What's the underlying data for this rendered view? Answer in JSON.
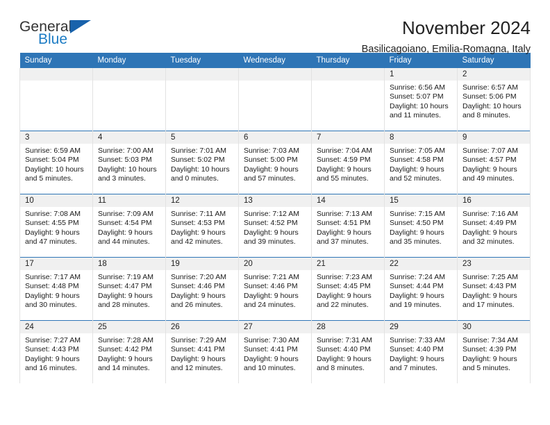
{
  "brand": {
    "name_top": "General",
    "name_bottom": "Blue",
    "accent_color": "#1862ab",
    "blue_text_color": "#1d7cc4"
  },
  "header": {
    "title": "November 2024",
    "subtitle": "Basilicagoiano, Emilia-Romagna, Italy"
  },
  "calendar": {
    "header_bg": "#2e75b6",
    "daynum_bg": "#f0f0f0",
    "weekdays": [
      "Sunday",
      "Monday",
      "Tuesday",
      "Wednesday",
      "Thursday",
      "Friday",
      "Saturday"
    ],
    "weeks": [
      [
        {
          "day": "",
          "empty": true,
          "sunrise": "",
          "sunset": "",
          "daylight_1": "",
          "daylight_2": ""
        },
        {
          "day": "",
          "empty": true,
          "sunrise": "",
          "sunset": "",
          "daylight_1": "",
          "daylight_2": ""
        },
        {
          "day": "",
          "empty": true,
          "sunrise": "",
          "sunset": "",
          "daylight_1": "",
          "daylight_2": ""
        },
        {
          "day": "",
          "empty": true,
          "sunrise": "",
          "sunset": "",
          "daylight_1": "",
          "daylight_2": ""
        },
        {
          "day": "",
          "empty": true,
          "sunrise": "",
          "sunset": "",
          "daylight_1": "",
          "daylight_2": ""
        },
        {
          "day": "1",
          "sunrise": "Sunrise: 6:56 AM",
          "sunset": "Sunset: 5:07 PM",
          "daylight_1": "Daylight: 10 hours",
          "daylight_2": "and 11 minutes."
        },
        {
          "day": "2",
          "sunrise": "Sunrise: 6:57 AM",
          "sunset": "Sunset: 5:06 PM",
          "daylight_1": "Daylight: 10 hours",
          "daylight_2": "and 8 minutes."
        }
      ],
      [
        {
          "day": "3",
          "sunrise": "Sunrise: 6:59 AM",
          "sunset": "Sunset: 5:04 PM",
          "daylight_1": "Daylight: 10 hours",
          "daylight_2": "and 5 minutes."
        },
        {
          "day": "4",
          "sunrise": "Sunrise: 7:00 AM",
          "sunset": "Sunset: 5:03 PM",
          "daylight_1": "Daylight: 10 hours",
          "daylight_2": "and 3 minutes."
        },
        {
          "day": "5",
          "sunrise": "Sunrise: 7:01 AM",
          "sunset": "Sunset: 5:02 PM",
          "daylight_1": "Daylight: 10 hours",
          "daylight_2": "and 0 minutes."
        },
        {
          "day": "6",
          "sunrise": "Sunrise: 7:03 AM",
          "sunset": "Sunset: 5:00 PM",
          "daylight_1": "Daylight: 9 hours",
          "daylight_2": "and 57 minutes."
        },
        {
          "day": "7",
          "sunrise": "Sunrise: 7:04 AM",
          "sunset": "Sunset: 4:59 PM",
          "daylight_1": "Daylight: 9 hours",
          "daylight_2": "and 55 minutes."
        },
        {
          "day": "8",
          "sunrise": "Sunrise: 7:05 AM",
          "sunset": "Sunset: 4:58 PM",
          "daylight_1": "Daylight: 9 hours",
          "daylight_2": "and 52 minutes."
        },
        {
          "day": "9",
          "sunrise": "Sunrise: 7:07 AM",
          "sunset": "Sunset: 4:57 PM",
          "daylight_1": "Daylight: 9 hours",
          "daylight_2": "and 49 minutes."
        }
      ],
      [
        {
          "day": "10",
          "sunrise": "Sunrise: 7:08 AM",
          "sunset": "Sunset: 4:55 PM",
          "daylight_1": "Daylight: 9 hours",
          "daylight_2": "and 47 minutes."
        },
        {
          "day": "11",
          "sunrise": "Sunrise: 7:09 AM",
          "sunset": "Sunset: 4:54 PM",
          "daylight_1": "Daylight: 9 hours",
          "daylight_2": "and 44 minutes."
        },
        {
          "day": "12",
          "sunrise": "Sunrise: 7:11 AM",
          "sunset": "Sunset: 4:53 PM",
          "daylight_1": "Daylight: 9 hours",
          "daylight_2": "and 42 minutes."
        },
        {
          "day": "13",
          "sunrise": "Sunrise: 7:12 AM",
          "sunset": "Sunset: 4:52 PM",
          "daylight_1": "Daylight: 9 hours",
          "daylight_2": "and 39 minutes."
        },
        {
          "day": "14",
          "sunrise": "Sunrise: 7:13 AM",
          "sunset": "Sunset: 4:51 PM",
          "daylight_1": "Daylight: 9 hours",
          "daylight_2": "and 37 minutes."
        },
        {
          "day": "15",
          "sunrise": "Sunrise: 7:15 AM",
          "sunset": "Sunset: 4:50 PM",
          "daylight_1": "Daylight: 9 hours",
          "daylight_2": "and 35 minutes."
        },
        {
          "day": "16",
          "sunrise": "Sunrise: 7:16 AM",
          "sunset": "Sunset: 4:49 PM",
          "daylight_1": "Daylight: 9 hours",
          "daylight_2": "and 32 minutes."
        }
      ],
      [
        {
          "day": "17",
          "sunrise": "Sunrise: 7:17 AM",
          "sunset": "Sunset: 4:48 PM",
          "daylight_1": "Daylight: 9 hours",
          "daylight_2": "and 30 minutes."
        },
        {
          "day": "18",
          "sunrise": "Sunrise: 7:19 AM",
          "sunset": "Sunset: 4:47 PM",
          "daylight_1": "Daylight: 9 hours",
          "daylight_2": "and 28 minutes."
        },
        {
          "day": "19",
          "sunrise": "Sunrise: 7:20 AM",
          "sunset": "Sunset: 4:46 PM",
          "daylight_1": "Daylight: 9 hours",
          "daylight_2": "and 26 minutes."
        },
        {
          "day": "20",
          "sunrise": "Sunrise: 7:21 AM",
          "sunset": "Sunset: 4:46 PM",
          "daylight_1": "Daylight: 9 hours",
          "daylight_2": "and 24 minutes."
        },
        {
          "day": "21",
          "sunrise": "Sunrise: 7:23 AM",
          "sunset": "Sunset: 4:45 PM",
          "daylight_1": "Daylight: 9 hours",
          "daylight_2": "and 22 minutes."
        },
        {
          "day": "22",
          "sunrise": "Sunrise: 7:24 AM",
          "sunset": "Sunset: 4:44 PM",
          "daylight_1": "Daylight: 9 hours",
          "daylight_2": "and 19 minutes."
        },
        {
          "day": "23",
          "sunrise": "Sunrise: 7:25 AM",
          "sunset": "Sunset: 4:43 PM",
          "daylight_1": "Daylight: 9 hours",
          "daylight_2": "and 17 minutes."
        }
      ],
      [
        {
          "day": "24",
          "sunrise": "Sunrise: 7:27 AM",
          "sunset": "Sunset: 4:43 PM",
          "daylight_1": "Daylight: 9 hours",
          "daylight_2": "and 16 minutes."
        },
        {
          "day": "25",
          "sunrise": "Sunrise: 7:28 AM",
          "sunset": "Sunset: 4:42 PM",
          "daylight_1": "Daylight: 9 hours",
          "daylight_2": "and 14 minutes."
        },
        {
          "day": "26",
          "sunrise": "Sunrise: 7:29 AM",
          "sunset": "Sunset: 4:41 PM",
          "daylight_1": "Daylight: 9 hours",
          "daylight_2": "and 12 minutes."
        },
        {
          "day": "27",
          "sunrise": "Sunrise: 7:30 AM",
          "sunset": "Sunset: 4:41 PM",
          "daylight_1": "Daylight: 9 hours",
          "daylight_2": "and 10 minutes."
        },
        {
          "day": "28",
          "sunrise": "Sunrise: 7:31 AM",
          "sunset": "Sunset: 4:40 PM",
          "daylight_1": "Daylight: 9 hours",
          "daylight_2": "and 8 minutes."
        },
        {
          "day": "29",
          "sunrise": "Sunrise: 7:33 AM",
          "sunset": "Sunset: 4:40 PM",
          "daylight_1": "Daylight: 9 hours",
          "daylight_2": "and 7 minutes."
        },
        {
          "day": "30",
          "sunrise": "Sunrise: 7:34 AM",
          "sunset": "Sunset: 4:39 PM",
          "daylight_1": "Daylight: 9 hours",
          "daylight_2": "and 5 minutes."
        }
      ]
    ]
  }
}
